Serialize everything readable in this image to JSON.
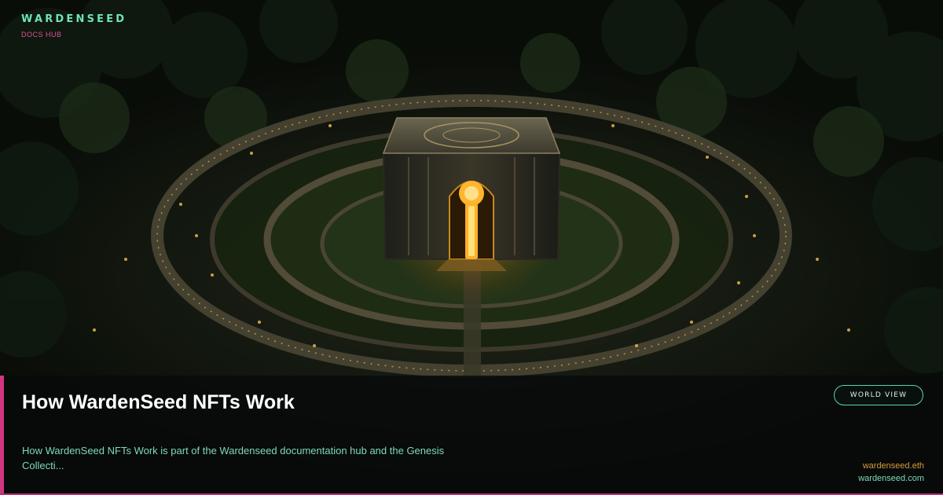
{
  "brand": {
    "name": "WARDENSEED",
    "subtitle": "DOCS HUB"
  },
  "hero_image": {
    "subject": "aerial view of a glowing stone vault at the center of concentric garden rings in a night forest city"
  },
  "panel": {
    "title": "How WardenSeed NFTs Work",
    "description": "How WardenSeed NFTs Work is part of the Wardenseed documentation hub and the Genesis Collecti...",
    "button_label": "WORLD VIEW",
    "links": {
      "ens": "wardenseed.eth",
      "site": "wardenseed.com"
    }
  },
  "colors": {
    "accent_pink": "#d2357f",
    "brand_green": "#6fe3b3",
    "text_green": "#7fd9b4",
    "link_gold": "#d89a3c",
    "title_white": "#ffffff"
  }
}
